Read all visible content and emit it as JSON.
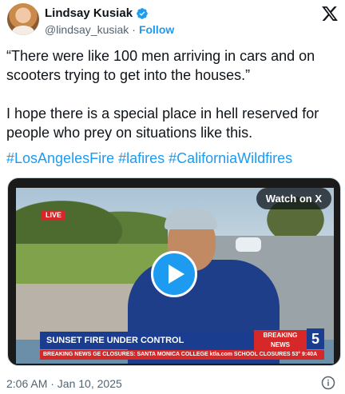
{
  "author": {
    "name": "Lindsay Kusiak",
    "handle": "@lindsay_kusiak",
    "separator": "·",
    "follow_label": "Follow",
    "verified": true
  },
  "brand": {
    "logo_icon": "x-logo-icon"
  },
  "tweet": {
    "paragraph_1": "“There were like 100 men arriving in cars and on scooters trying to get into the houses.”",
    "paragraph_2": "I hope there is a special place in hell reserved for people who prey on situations like this.",
    "hashtags": [
      "#LosAngelesFire",
      "#lafires",
      "#CaliforniaWildfires"
    ]
  },
  "media": {
    "watch_label": "Watch on X",
    "play_icon": "play-icon",
    "tv": {
      "live_label": "LIVE",
      "headline": "SUNSET FIRE UNDER CONTROL",
      "breaking_label_1": "BREAKING",
      "breaking_label_2": "NEWS",
      "channel": "5",
      "ticker": "BREAKING NEWS  GE CLOSURES: SANTA MONICA COLLEGE  ktla.com  SCHOOL CLOSURES  53°  9:40A"
    }
  },
  "footer": {
    "timestamp": "2:06 AM · Jan 10, 2025",
    "info_icon": "info-icon"
  },
  "colors": {
    "accent": "#1d9bf0",
    "text": "#0f1419",
    "muted": "#536471"
  }
}
